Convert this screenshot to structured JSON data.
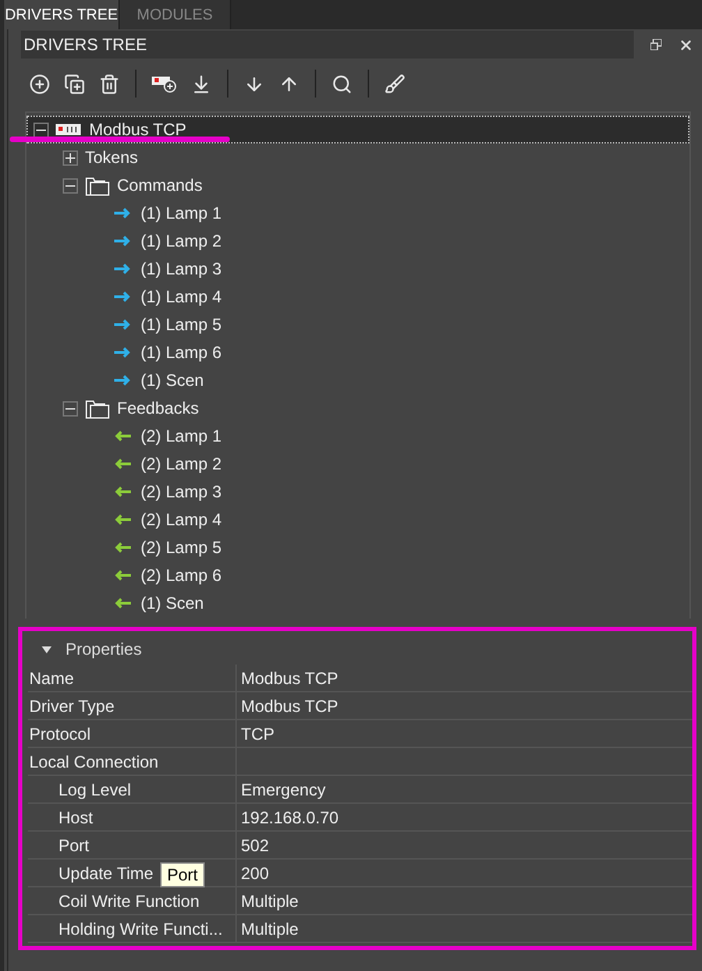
{
  "tabs": [
    {
      "label": "DRIVERS TREE",
      "selected": true
    },
    {
      "label": "MODULES",
      "selected": false
    }
  ],
  "panel": {
    "title": "DRIVERS TREE"
  },
  "tree": [
    {
      "label": "Modbus TCP",
      "kind": "driver",
      "expanded": true,
      "selected": true,
      "children": [
        {
          "label": "Tokens",
          "kind": "group",
          "expanded": false,
          "selected": false
        },
        {
          "label": "Commands",
          "kind": "folder",
          "expanded": true,
          "selected": false,
          "children": [
            {
              "label": "(1) Lamp 1",
              "kind": "command",
              "selected": false
            },
            {
              "label": "(1) Lamp 2",
              "kind": "command",
              "selected": false
            },
            {
              "label": "(1) Lamp 3",
              "kind": "command",
              "selected": false
            },
            {
              "label": "(1) Lamp 4",
              "kind": "command",
              "selected": false
            },
            {
              "label": "(1) Lamp 5",
              "kind": "command",
              "selected": false
            },
            {
              "label": "(1) Lamp 6",
              "kind": "command",
              "selected": false
            },
            {
              "label": "(1) Scen",
              "kind": "command",
              "selected": false
            }
          ]
        },
        {
          "label": "Feedbacks",
          "kind": "folder",
          "expanded": true,
          "selected": false,
          "children": [
            {
              "label": "(2) Lamp 1",
              "kind": "feedback",
              "selected": false
            },
            {
              "label": "(2) Lamp 2",
              "kind": "feedback",
              "selected": false
            },
            {
              "label": "(2) Lamp 3",
              "kind": "feedback",
              "selected": false
            },
            {
              "label": "(2) Lamp 4",
              "kind": "feedback",
              "selected": false
            },
            {
              "label": "(2) Lamp 5",
              "kind": "feedback",
              "selected": false
            },
            {
              "label": "(2) Lamp 6",
              "kind": "feedback",
              "selected": false
            },
            {
              "label": "(1) Scen",
              "kind": "feedback",
              "selected": false
            }
          ]
        }
      ]
    }
  ],
  "properties": {
    "title": "Properties",
    "expanded": true,
    "rows": [
      {
        "name": "Name",
        "value": "Modbus TCP"
      },
      {
        "name": "Driver Type",
        "value": "Modbus TCP"
      },
      {
        "name": "Protocol",
        "value": "TCP"
      },
      {
        "name": "Local Connection",
        "children": [
          {
            "name": "Log Level",
            "value": "Emergency"
          },
          {
            "name": "Host",
            "value": "192.168.0.70"
          },
          {
            "name": "Port",
            "value": "502"
          },
          {
            "name": "Update Time",
            "value": "200",
            "tooltip": "Port"
          },
          {
            "name": "Coil Write Function",
            "value": "Multiple"
          },
          {
            "name": "Holding Write Functi...",
            "value": "Multiple"
          }
        ]
      }
    ]
  },
  "highlights": {
    "underline": true,
    "frame": true
  }
}
